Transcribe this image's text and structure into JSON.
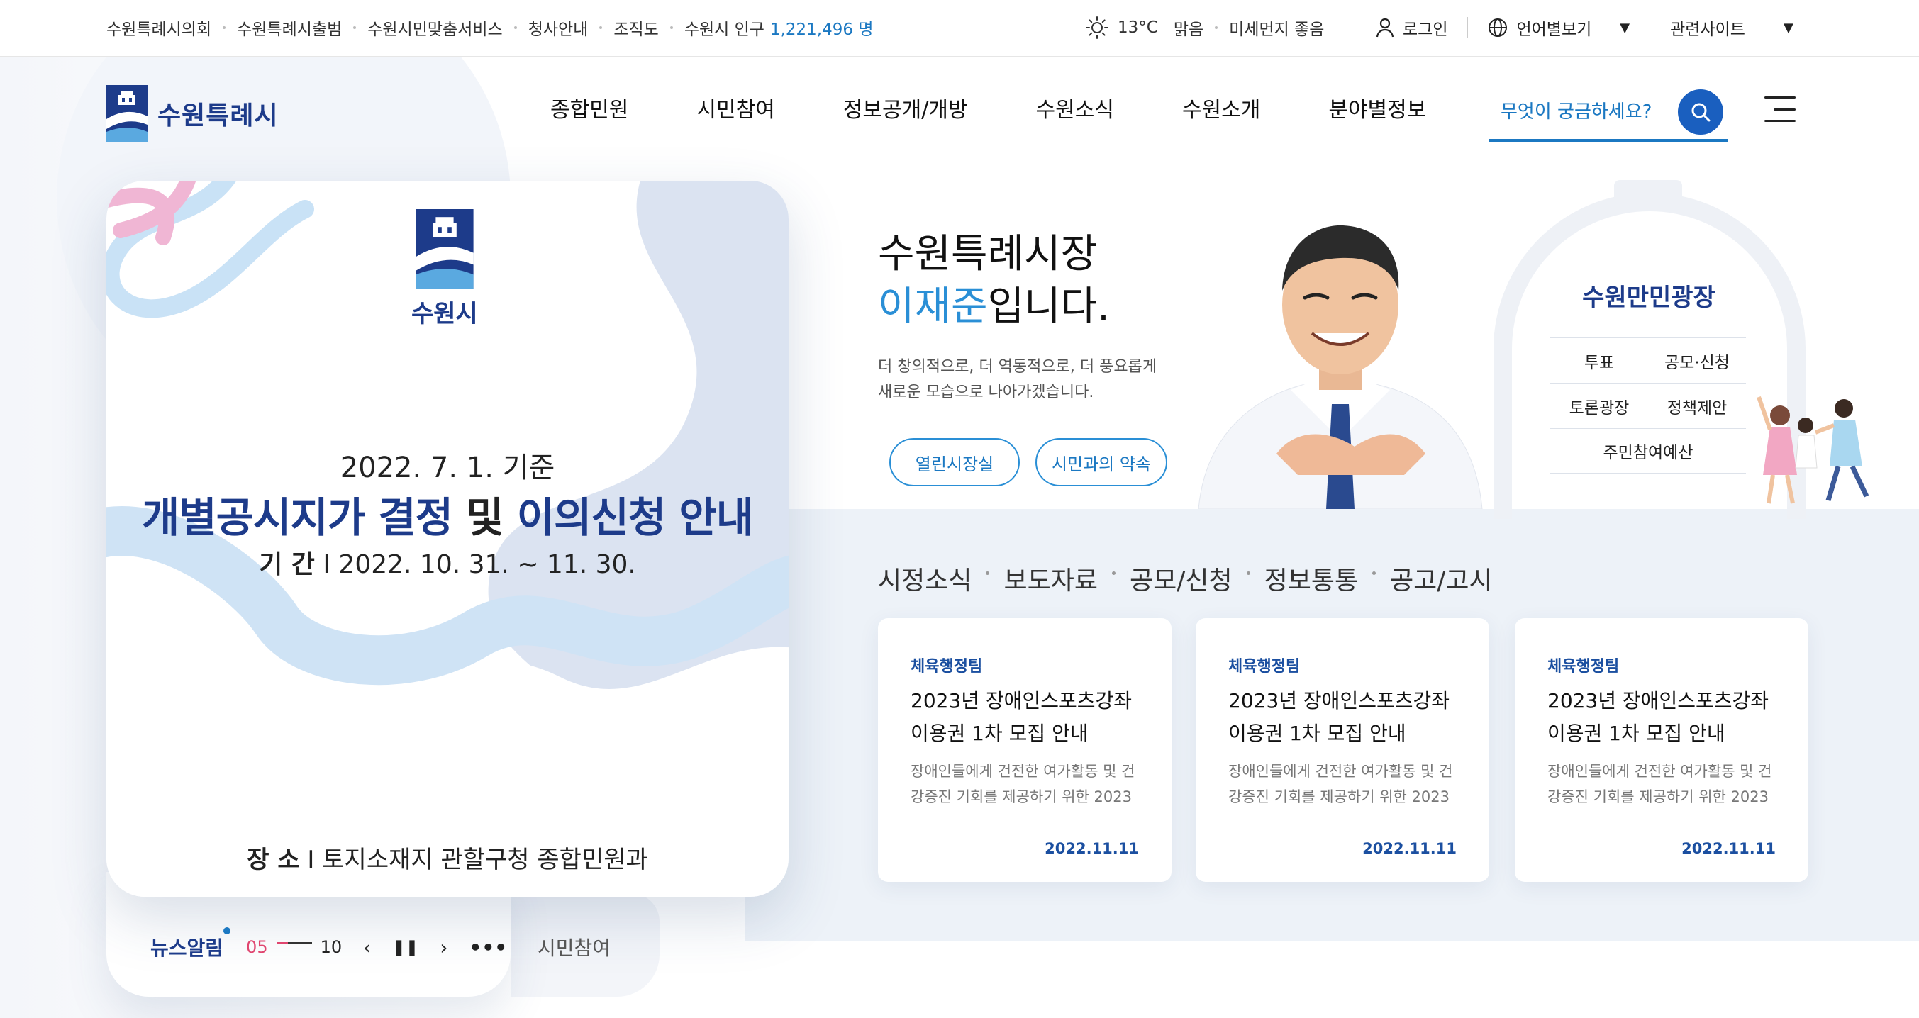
{
  "utility": {
    "links": [
      "수원특례시의회",
      "수원특례시출범",
      "수원시민맞춤서비스",
      "청사안내",
      "조직도"
    ],
    "population_label": "수원시 인구",
    "population_value": "1,221,496 명",
    "weather": {
      "temp": "13°C",
      "condition": "맑음",
      "dust": "미세먼지 좋음"
    },
    "login": "로그인",
    "language": "언어별보기",
    "related": "관련사이트"
  },
  "header": {
    "logo_text": "수원특례시",
    "nav": [
      "종합민원",
      "시민참여",
      "정보공개/개방",
      "수원소식",
      "수원소개",
      "분야별정보"
    ],
    "search_placeholder": "무엇이 궁금하세요?"
  },
  "banner": {
    "logo_text": "수원시",
    "date": "2022. 7. 1. 기준",
    "title_part1": "개별공시지가 결정",
    "title_mid": "및",
    "title_part2": "이의신청 안내",
    "period_label": "기 간",
    "period_value": "I 2022. 10. 31. ~ 11. 30.",
    "place_label": "장 소",
    "place_value": "I 토지소재지 관할구청 종합민원과"
  },
  "tabs": {
    "news": "뉴스알림",
    "current": "05",
    "total": "10",
    "citizen": "시민참여"
  },
  "mayor": {
    "line1": "수원특례시장",
    "name": "이재준",
    "suffix": "입니다.",
    "desc1": "더 창의적으로, 더 역동적으로, 더 풍요롭게",
    "desc2": "새로운 모습으로 나아가겠습니다.",
    "btn1": "열린시장실",
    "btn2": "시민과의 약속"
  },
  "plaza": {
    "title": "수원만민광장",
    "items": [
      "투표",
      "공모·신청",
      "토론광장",
      "정책제안",
      "주민참여예산"
    ]
  },
  "news": {
    "tabs": [
      "시정소식",
      "보도자료",
      "공모/신청",
      "정보통통",
      "공고/고시"
    ],
    "cards": [
      {
        "dept": "체육행정팀",
        "title1": "2023년 장애인스포츠강좌",
        "title2": "이용권 1차 모집 안내",
        "sum1": "장애인들에게 건전한 여가활동 및 건",
        "sum2": "강증진 기회를 제공하기 위한 2023",
        "date": "2022.11.11"
      },
      {
        "dept": "체육행정팀",
        "title1": "2023년 장애인스포츠강좌",
        "title2": "이용권 1차 모집 안내",
        "sum1": "장애인들에게 건전한 여가활동 및 건",
        "sum2": "강증진 기회를 제공하기 위한 2023",
        "date": "2022.11.11"
      },
      {
        "dept": "체육행정팀",
        "title1": "2023년 장애인스포츠강좌",
        "title2": "이용권 1차 모집 안내",
        "sum1": "장애인들에게 건전한 여가활동 및 건",
        "sum2": "강증진 기회를 제공하기 위한 2023",
        "date": "2022.11.11"
      }
    ]
  },
  "colors": {
    "brand": "#1d3b8a",
    "accent": "#1b78c2",
    "highlight": "#2a8fd6",
    "pink": "#e0456f"
  }
}
